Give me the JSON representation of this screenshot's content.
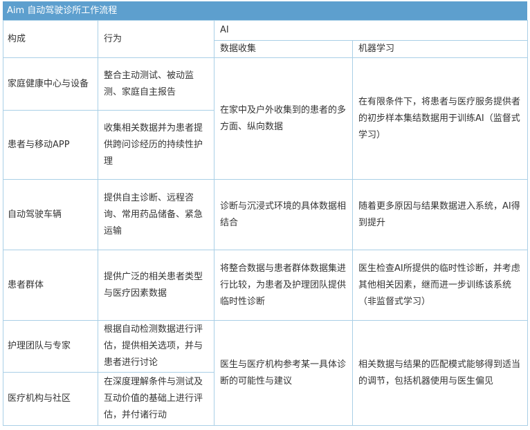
{
  "title": "Aim 自动驾驶诊所工作流程",
  "headers": {
    "col1": "构成",
    "col2": "行为",
    "ai": "AI",
    "data_collection": "数据收集",
    "machine_learning": "机器学习"
  },
  "rows": [
    {
      "component": "家庭健康中心与设备",
      "behavior": "整合主动测试、被动监测、家庭自主报告"
    },
    {
      "component": "患者与移动APP",
      "behavior": "收集相关数据并为患者提供跨问诊经历的持续性护理"
    },
    {
      "component": "自动驾驶车辆",
      "behavior": "提供自主诊断、远程咨询、常用药品储备、紧急运输"
    },
    {
      "component": "患者群体",
      "behavior": "提供广泛的相关患者类型与医疗因素数据"
    },
    {
      "component": "护理团队与专家",
      "behavior": "根据自动检测数据进行评估，提供相关选项，并与患者进行讨论"
    },
    {
      "component": "医疗机构与社区",
      "behavior": "在深度理解条件与测试及互动价值的基础上进行评估，并付诸行动"
    }
  ],
  "ai_groups": [
    {
      "data_collection": "在家中及户外收集到的患者的多方面、纵向数据",
      "machine_learning": "在有限条件下，将患者与医疗服务提供者的初步样本集结数据用于训练AI（监督式学习）"
    },
    {
      "data_collection": "诊断与沉浸式环境的具体数据相结合",
      "machine_learning": "随着更多原因与结果数据进入系统，AI得到提升"
    },
    {
      "data_collection": "将整合数据与患者群体数据集进行比较，为患者及护理团队提供临时性诊断",
      "machine_learning": "医生检查AI所提供的临时性诊断，并考虑其他相关因素，继而进一步训练该系统（非监督式学习）"
    },
    {
      "data_collection": "医生与医疗机构参考某一具体诊断的可能性与建议",
      "machine_learning": "相关数据与结果的匹配模式能够得到适当的调节，包括机器使用与医生偏见"
    }
  ]
}
